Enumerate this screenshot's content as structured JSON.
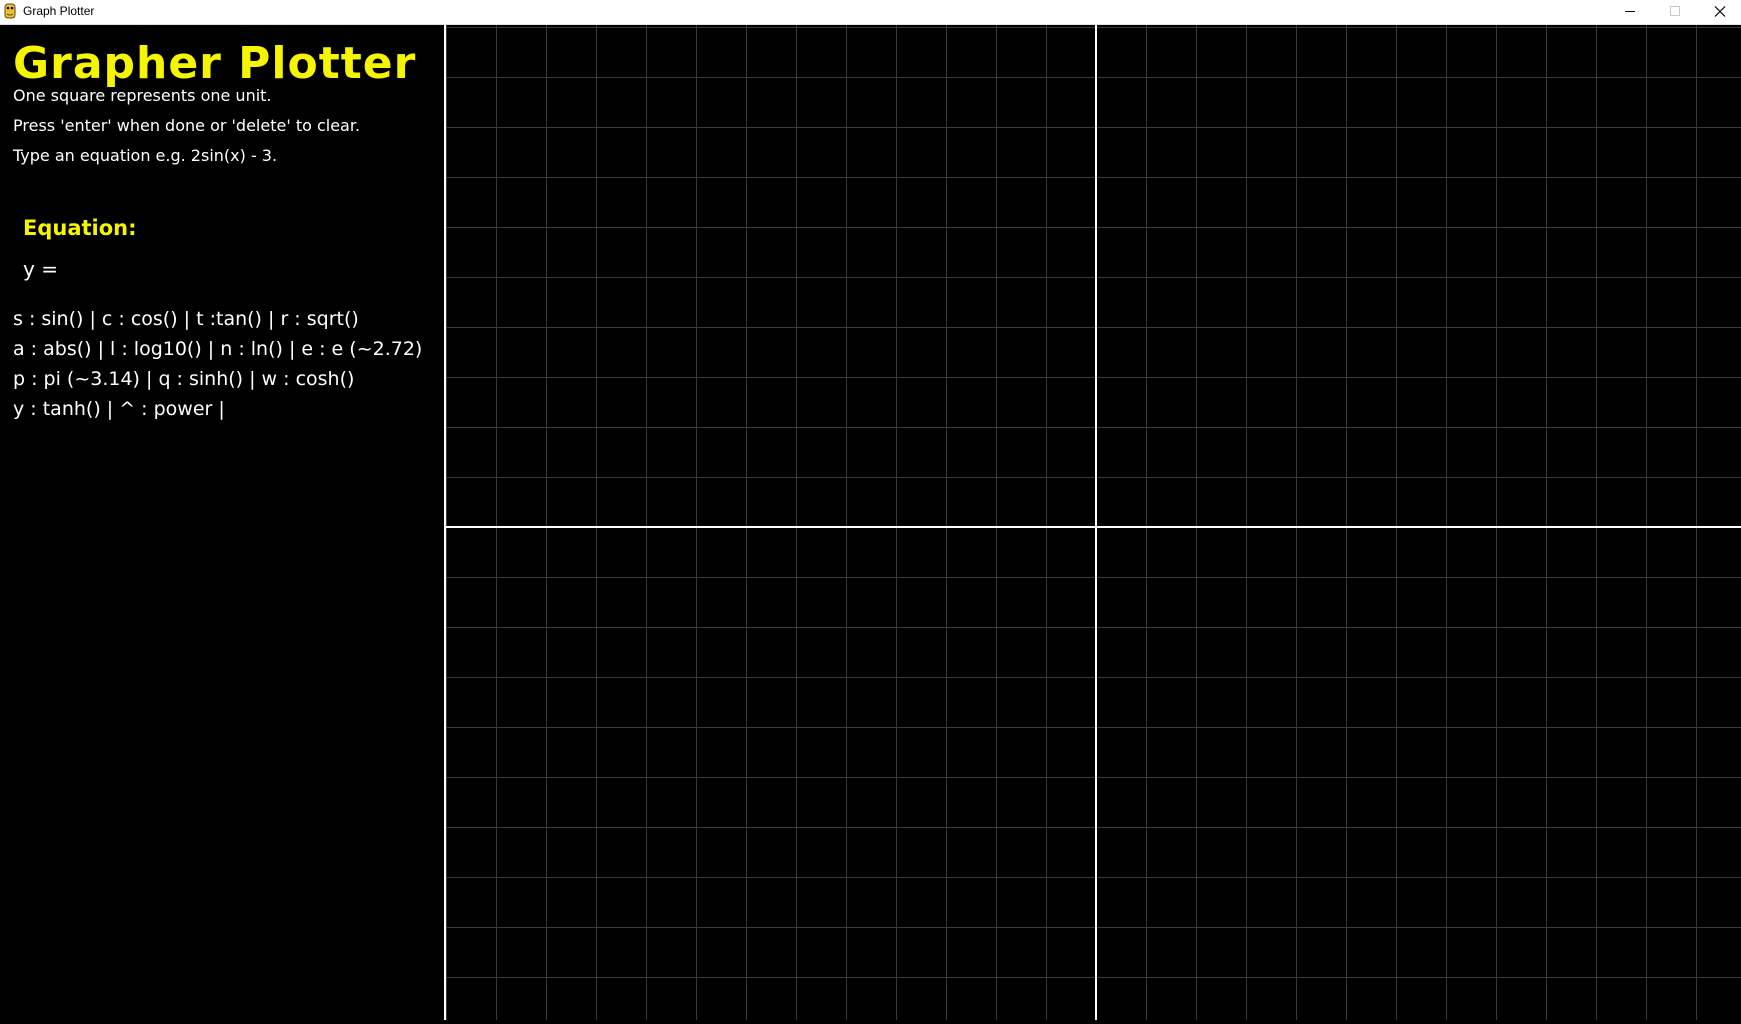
{
  "window": {
    "title": "Graph Plotter",
    "icon": "python-snake-icon"
  },
  "sidebar": {
    "heading": "Grapher Plotter",
    "hints": [
      "One square represents one unit.",
      "Press 'enter' when done or 'delete' to clear.",
      "Type an equation e.g. 2sin(x) - 3."
    ],
    "equation_label": "Equation:",
    "equation_value": "y = ",
    "reference": [
      "s : sin() | c : cos() | t :tan() | r :  sqrt()",
      "a : abs() | l : log10() | n : ln() | e : e (~2.72)",
      "p : pi (~3.14) | q : sinh() | w : cosh()",
      "y : tanh() | ^ : power |"
    ]
  },
  "colors": {
    "accent": "#f5f500",
    "background": "#000000",
    "text": "#ffffff",
    "grid": "#3a3a3a",
    "axis": "#ffffff"
  },
  "plot": {
    "unit_per_square": 1,
    "x_range": [
      -13,
      13
    ],
    "y_range": [
      -10,
      10
    ],
    "axes_visible": true,
    "grid_visible": true
  }
}
